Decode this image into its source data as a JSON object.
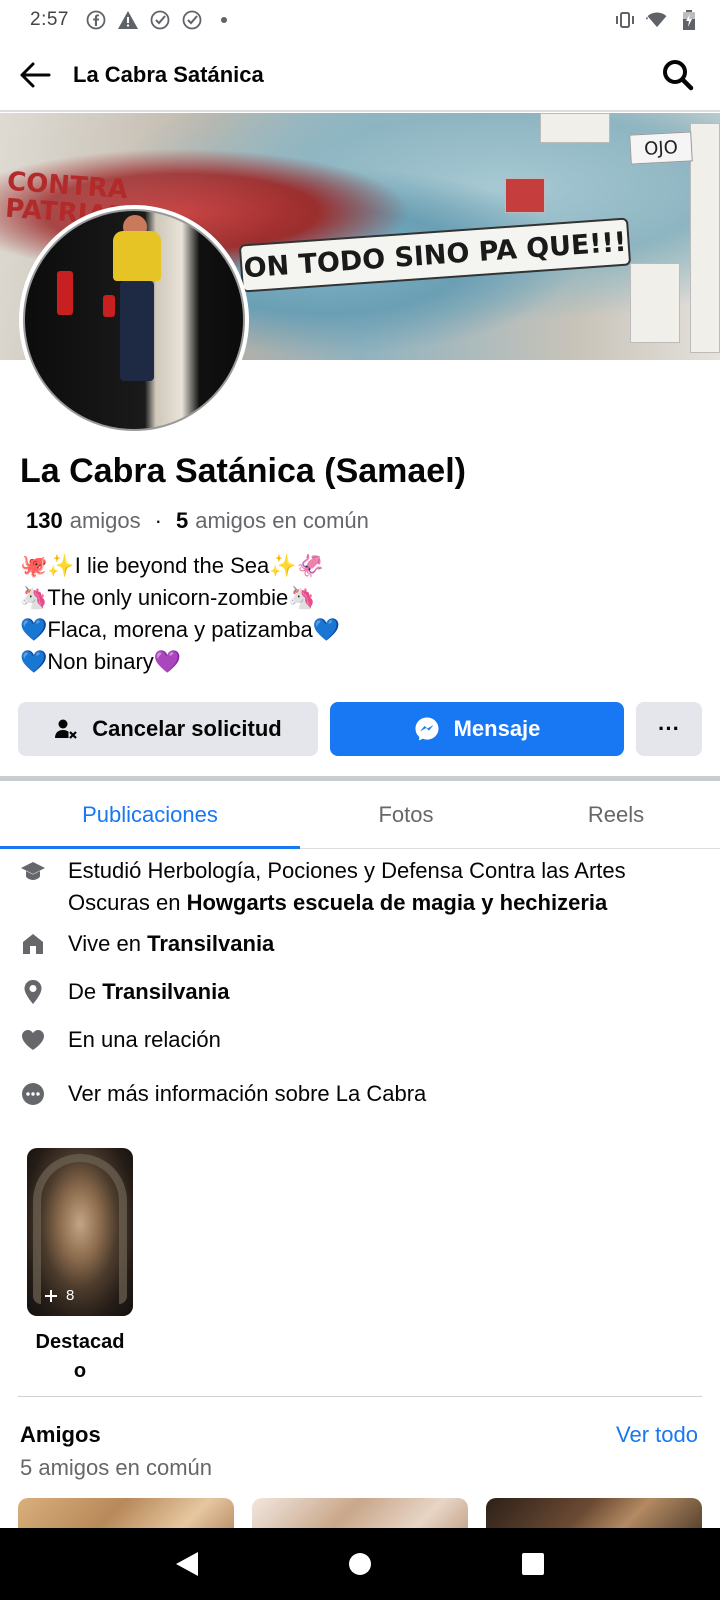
{
  "status_bar": {
    "time": "2:57",
    "left_icons": [
      "facebook-icon",
      "warning-icon",
      "check-circle-icon",
      "check-circle-icon",
      "dot-icon"
    ],
    "right_icons": [
      "vibrate-icon",
      "wifi-icon",
      "battery-icon"
    ]
  },
  "header": {
    "title": "La Cabra Satánica",
    "back_icon": "arrow-left-icon",
    "search_icon": "search-icon"
  },
  "cover": {
    "banner_text": "ON TODO SINO PA QUE!!!",
    "wall_text": "CONTRA\nPATRIAR",
    "sign_text": "OJO"
  },
  "profile": {
    "name": "La Cabra Satánica (Samael)",
    "friends_count": "130",
    "friends_label": "amigos",
    "separator": "·",
    "mutual_count": "5",
    "mutual_label": "amigos en común",
    "bio": [
      "🐙✨I lie beyond the Sea✨🦑",
      "🦄The only unicorn-zombie🦄",
      "💙Flaca, morena y patizamba💙",
      "💙Non binary💜"
    ]
  },
  "actions": {
    "cancel_label": "Cancelar solicitud",
    "message_label": "Mensaje",
    "more_label": "···"
  },
  "tabs": [
    {
      "label": "Publicaciones",
      "active": true
    },
    {
      "label": "Fotos",
      "active": false
    },
    {
      "label": "Reels",
      "active": false
    }
  ],
  "about": {
    "study_prefix": "Estudió Herbología, Pociones y Defensa Contra las Artes Oscuras en ",
    "study_place": "Howgarts escuela de magia y hechizeria",
    "lives_prefix": "Vive en ",
    "lives_place": "Transilvania",
    "from_prefix": "De ",
    "from_place": "Transilvania",
    "relationship": "En una relación",
    "more_info": "Ver más información sobre La Cabra"
  },
  "highlights": {
    "count": "8",
    "label": "Destacad o"
  },
  "friends_section": {
    "title": "Amigos",
    "see_all": "Ver todo",
    "subtitle": "5 amigos en común"
  },
  "colors": {
    "accent": "#1877f2",
    "secondary_text": "#65676b",
    "button_gray": "#e4e6eb"
  }
}
